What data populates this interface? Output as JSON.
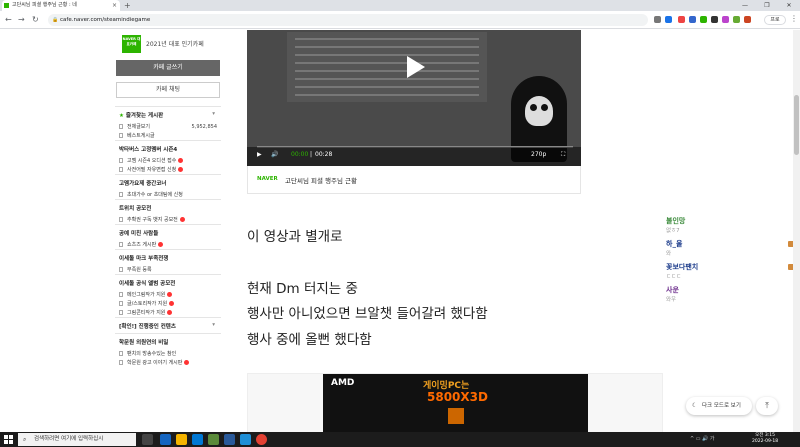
{
  "browser": {
    "tab_title": "고단씨님 피셜 행주님 근황 : 네",
    "tab_close": "×",
    "new_tab": "+",
    "url": "cafe.naver.com/steamindiegame",
    "profile_label": "프로"
  },
  "sidebar": {
    "badge_text": "NAVER 대표카페",
    "cafe_rank": "2021년 대표 인기카페",
    "write_button": "카페 글쓰기",
    "chat_button": "카페 채팅",
    "sections": [
      {
        "title": "즐겨찾는 게시판",
        "starred": true,
        "items": [
          {
            "label": "전체글보기",
            "count": "5,952,854"
          },
          {
            "label": "베스트게시글"
          }
        ]
      },
      {
        "title": "박타버스 고정멤버 시즌4",
        "items": [
          {
            "label": "고멤 시즌4 오디션 접수",
            "new": true
          },
          {
            "label": "사전어필 자유면접 신청",
            "new": true
          }
        ]
      },
      {
        "title": "고멤가요제 중간코너",
        "items": [
          {
            "label": "초대가수 or 초대팀에 신청"
          }
        ]
      },
      {
        "title": "트위치 공모전",
        "items": [
          {
            "label": "추확권 구독 뱃지 공모전",
            "new": true
          }
        ]
      },
      {
        "title": "공예 미친 사람들",
        "items": [
          {
            "label": "쇼츠즈 게시판",
            "new": true
          }
        ]
      },
      {
        "title": "이세돌 마크 부족전쟁",
        "items": [
          {
            "label": "부족원 등록"
          }
        ]
      },
      {
        "title": "이세돌 공식 앨범 공모전",
        "items": [
          {
            "label": "메인그림작가 지원",
            "new": true
          },
          {
            "label": "글/스토리작가 지원",
            "new": true
          },
          {
            "label": "그림콘티작가 지원",
            "new": true
          }
        ]
      },
      {
        "title": "[확인!] 진행중인 컨텐츠",
        "items": []
      },
      {
        "title": "학문원 외원연의 비밀",
        "items": [
          {
            "label": "팬치의 방송수있는 참인"
          },
          {
            "label": "학문원 광고 이야기 게시판",
            "new": true
          }
        ]
      }
    ]
  },
  "video": {
    "time_current": "00:00",
    "time_total": "00:28",
    "quality": "270p",
    "caption_source": "NAVER",
    "caption_title": "고단씨님 피셜 행주님 근황"
  },
  "article": {
    "lines": [
      "이 영상과 별개로",
      "현재 Dm 터지는 중",
      "행사만 아니었으면 브알챗 들어갈려 했다함",
      "행사 중에 올뻔 했다함"
    ]
  },
  "ad": {
    "brand": "AMD",
    "headline": "게이밍PC는",
    "product": "5800X3D"
  },
  "right_list": [
    {
      "name": "불인망",
      "sub": "없ㅎ7",
      "color": "#3a8a3a"
    },
    {
      "name": "하_울",
      "sub": "와",
      "color": "#1a3a8a"
    },
    {
      "name": "꽃보다팬치",
      "sub": "ㄷㄷㄷ",
      "color": "#1a3a8a"
    },
    {
      "name": "사운",
      "sub": "와우",
      "color": "#6a2a8a"
    }
  ],
  "floating": {
    "darkmode": "다크 모드로 보기",
    "totop": "⤒"
  },
  "taskbar": {
    "search_placeholder": "검색하려면 여기에 입력하십시",
    "time": "오전 3:15",
    "date": "2022-09-18"
  },
  "colors": {
    "naver_green": "#2db400",
    "sidebar_write_bg": "#666666",
    "new_dot": "#ff3333"
  }
}
